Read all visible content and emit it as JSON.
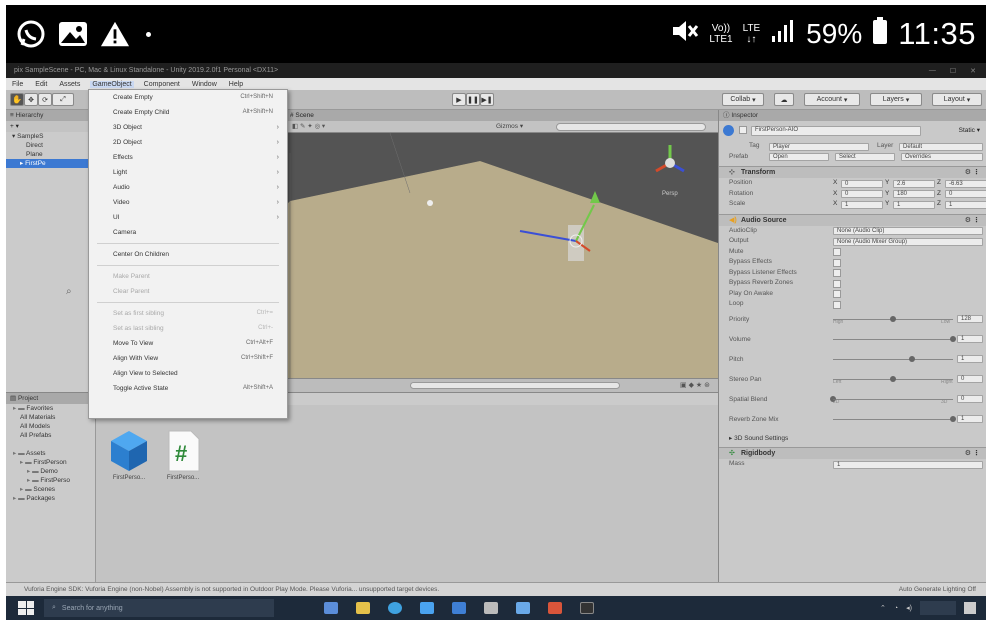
{
  "phone_status": {
    "network_top": "Vo))",
    "network_bottom": "LTE1",
    "lte_top": "LTE",
    "lte_bottom": "↓↑",
    "battery": "59%",
    "time": "11:35"
  },
  "window": {
    "title": "pix SampleScene - PC, Mac & Linux Standalone - Unity 2019.2.0f1 Personal <DX11>"
  },
  "menu_bar": {
    "items": [
      "File",
      "Edit",
      "Assets",
      "GameObject",
      "Component",
      "Window",
      "Help"
    ]
  },
  "toolbar": {
    "collab": "Collab",
    "account": "Account",
    "layers": "Layers",
    "layout": "Layout"
  },
  "hierarchy": {
    "tab": "Hierarchy",
    "items": [
      "SampleS",
      "Direct",
      "Plane",
      "FirstPe"
    ]
  },
  "scene": {
    "tab": "Scene",
    "gizmos": "Gizmos",
    "persp": "Persp"
  },
  "dropdown": {
    "items": [
      {
        "label": "Create Empty",
        "shortcut": "Ctrl+Shift+N",
        "arrow": ""
      },
      {
        "label": "Create Empty Child",
        "shortcut": "Alt+Shift+N",
        "arrow": ""
      },
      {
        "label": "3D Object",
        "shortcut": "",
        "arrow": "›"
      },
      {
        "label": "2D Object",
        "shortcut": "",
        "arrow": "›"
      },
      {
        "label": "Effects",
        "shortcut": "",
        "arrow": "›"
      },
      {
        "label": "Light",
        "shortcut": "",
        "arrow": "›"
      },
      {
        "label": "Audio",
        "shortcut": "",
        "arrow": "›"
      },
      {
        "label": "Video",
        "shortcut": "",
        "arrow": "›"
      },
      {
        "label": "UI",
        "shortcut": "",
        "arrow": "›"
      },
      {
        "label": "Camera",
        "shortcut": "",
        "arrow": ""
      }
    ],
    "center": "Center On Children",
    "disabled_items": [
      "Make Parent",
      "Clear Parent"
    ],
    "disabled_items2": [
      {
        "label": "Set as first sibling",
        "shortcut": "Ctrl+="
      },
      {
        "label": "Set as last sibling",
        "shortcut": "Ctrl+-"
      }
    ],
    "bottom_items": [
      {
        "label": "Move To View",
        "shortcut": "Ctrl+Alt+F"
      },
      {
        "label": "Align With View",
        "shortcut": "Ctrl+Shift+F"
      },
      {
        "label": "Align View to Selected",
        "shortcut": ""
      },
      {
        "label": "Toggle Active State",
        "shortcut": "Alt+Shift+A"
      }
    ]
  },
  "project": {
    "tab": "Project",
    "tree": [
      {
        "label": "Favorites",
        "indent": 1,
        "folder": true
      },
      {
        "label": "All Materials",
        "indent": 2,
        "folder": false
      },
      {
        "label": "All Models",
        "indent": 2,
        "folder": false
      },
      {
        "label": "All Prefabs",
        "indent": 2,
        "folder": false
      },
      {
        "label": "",
        "indent": 0,
        "folder": false
      },
      {
        "label": "Assets",
        "indent": 1,
        "folder": true
      },
      {
        "label": "FirstPerson",
        "indent": 2,
        "folder": true
      },
      {
        "label": "Demo",
        "indent": 3,
        "folder": true
      },
      {
        "label": "FirstPerso",
        "indent": 3,
        "folder": true
      },
      {
        "label": "Scenes",
        "indent": 2,
        "folder": true
      },
      {
        "label": "Packages",
        "indent": 1,
        "folder": true
      }
    ],
    "assets": [
      {
        "name": "FirstPerso...",
        "type": "prefab"
      },
      {
        "name": "FirstPerso...",
        "type": "script"
      }
    ]
  },
  "inspector": {
    "tab": "Inspector",
    "object_name": "FirstPerson-AIO",
    "static_label": "Static",
    "tag_label": "Tag",
    "tag_value": "Player",
    "layer_label": "Layer",
    "layer_value": "Default",
    "prefab_label": "Prefab",
    "prefab_buttons": [
      "Open",
      "Select",
      "Overrides"
    ],
    "transform": {
      "title": "Transform",
      "rows": [
        {
          "label": "Position",
          "x": "0",
          "y": "2.6",
          "z": "-6.63"
        },
        {
          "label": "Rotation",
          "x": "0",
          "y": "180",
          "z": "0"
        },
        {
          "label": "Scale",
          "x": "1",
          "y": "1",
          "z": "1"
        }
      ]
    },
    "audio_source": {
      "title": "Audio Source",
      "audio_clip_label": "AudioClip",
      "audio_clip_value": "None (Audio Clip)",
      "output_label": "Output",
      "output_value": "None (Audio Mixer Group)",
      "checkboxes": [
        "Mute",
        "Bypass Effects",
        "Bypass Listener Effects",
        "Bypass Reverb Zones",
        "Play On Awake",
        "Loop"
      ],
      "sliders": [
        {
          "label": "Priority",
          "value": "128",
          "min_label": "High",
          "max_label": "Low",
          "level": 0.5
        },
        {
          "label": "Volume",
          "value": "1",
          "min_label": "",
          "max_label": "",
          "level": 1.0
        },
        {
          "label": "Pitch",
          "value": "1",
          "min_label": "",
          "max_label": "",
          "level": 0.66
        },
        {
          "label": "Stereo Pan",
          "value": "0",
          "min_label": "Left",
          "max_label": "Right",
          "level": 0.5
        },
        {
          "label": "Spatial Blend",
          "value": "0",
          "min_label": "2D",
          "max_label": "3D",
          "level": 0.0
        },
        {
          "label": "Reverb Zone Mix",
          "value": "1",
          "min_label": "",
          "max_label": "",
          "level": 1.0
        }
      ],
      "sound_settings": "3D Sound Settings"
    },
    "rigidbody": {
      "title": "Rigidbody",
      "mass_label": "Mass",
      "mass_value": "1"
    }
  },
  "status_line": {
    "text": "Vuforia Engine SDK: Vuforia Engine (non-Nobel) Assembly is not supported in Outdoor Play Mode. Please Vuforia... unsupported target devices.",
    "right": "Auto Generate Lighting Off"
  },
  "taskbar": {
    "search": "Search for anything"
  },
  "colors": {
    "accent": "#3c79d2",
    "taskbar": "#1d2a3a",
    "ground": "#b8ac8b"
  }
}
